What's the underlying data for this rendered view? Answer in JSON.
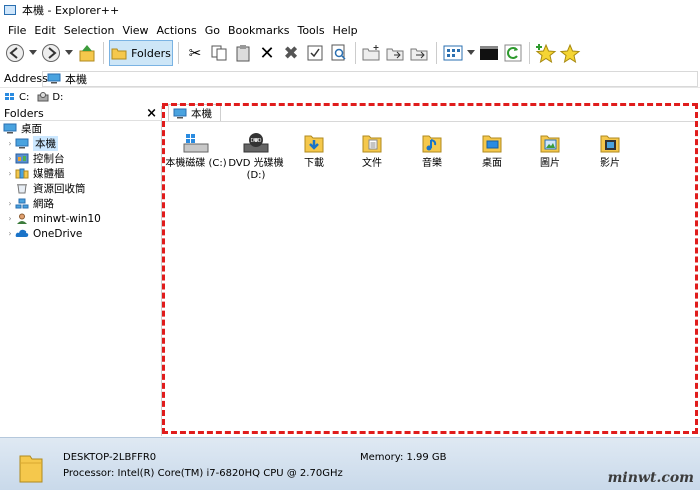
{
  "window": {
    "title": "本機 - Explorer++"
  },
  "menu": [
    "File",
    "Edit",
    "Selection",
    "View",
    "Actions",
    "Go",
    "Bookmarks",
    "Tools",
    "Help"
  ],
  "toolbar": {
    "folders_label": "Folders"
  },
  "address": {
    "label": "Address",
    "value": "本機"
  },
  "drives": [
    "C:",
    "D:"
  ],
  "folders_pane": {
    "title": "Folders",
    "close_glyph": "×",
    "tree": [
      {
        "label": "桌面",
        "level": 0
      },
      {
        "label": "本機",
        "level": 1,
        "selected": true
      },
      {
        "label": "控制台",
        "level": 1
      },
      {
        "label": "媒體櫃",
        "level": 1
      },
      {
        "label": "資源回收筒",
        "level": 1
      },
      {
        "label": "網路",
        "level": 1
      },
      {
        "label": "minwt-win10",
        "level": 1
      },
      {
        "label": "OneDrive",
        "level": 1
      }
    ]
  },
  "tab": {
    "label": "本機"
  },
  "files": [
    {
      "label": "本機磁碟 (C:)",
      "icon": "hard-drive"
    },
    {
      "label": "DVD 光碟機 (D:)",
      "icon": "dvd-drive"
    },
    {
      "label": "下載",
      "icon": "downloads-folder"
    },
    {
      "label": "文件",
      "icon": "documents-folder"
    },
    {
      "label": "音樂",
      "icon": "music-folder"
    },
    {
      "label": "桌面",
      "icon": "desktop-folder"
    },
    {
      "label": "圖片",
      "icon": "pictures-folder"
    },
    {
      "label": "影片",
      "icon": "videos-folder"
    }
  ],
  "status": {
    "computer": "DESKTOP-2LBFFR0",
    "processor": "Processor: Intel(R) Core(TM) i7-6820HQ CPU @ 2.70GHz",
    "memory": "Memory: 1.99 GB"
  },
  "watermark": "minwt.com",
  "colors": {
    "highlight": "#e01c1c",
    "selection": "#cce8ff",
    "folder": "#f5c84c"
  }
}
